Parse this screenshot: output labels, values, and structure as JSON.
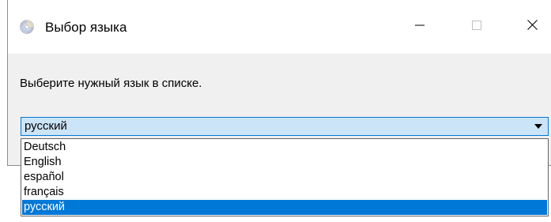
{
  "window": {
    "title": "Выбор языка",
    "icon": "cd-disc-icon",
    "controls": {
      "minimize_icon": "minimize-icon",
      "maximize_icon": "maximize-icon",
      "close_icon": "close-icon"
    }
  },
  "dialog": {
    "prompt": "Выберите нужный язык в списке.",
    "language_select": {
      "selected_value": "русский",
      "options": [
        "Deutsch",
        "English",
        "español",
        "français",
        "русский"
      ],
      "highlighted_index": 4
    }
  },
  "colors": {
    "accent": "#0078d7",
    "combo_background": "#cce4f7",
    "dialog_background": "#f0f0f0"
  }
}
